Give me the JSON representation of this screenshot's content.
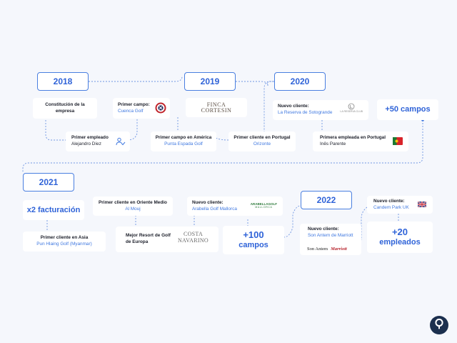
{
  "years": [
    "2018",
    "2019",
    "2020",
    "2021",
    "2022"
  ],
  "cards": {
    "constitucion": {
      "title": "Constitución de la empresa"
    },
    "primer_empleado": {
      "title": "Primer empleado",
      "sub": "Alejandro Díez"
    },
    "primer_campo": {
      "title": "Primer campo:",
      "sub": "Cuenca Golf"
    },
    "finca": {
      "logo_line1": "FINCA",
      "logo_line2": "CORTESIN"
    },
    "primer_campo_america": {
      "title": "Primer campo en América",
      "sub": "Punta Espada Golf"
    },
    "primer_cliente_portugal": {
      "title": "Primer cliente en Portugal",
      "sub": "Orizonte"
    },
    "reserva": {
      "title": "Nuevo cliente:",
      "sub": "La Reserva de Sotogrande",
      "logo_text": "LA RESERVA CLUB"
    },
    "primera_empleada_portugal": {
      "title": "Primera empleada en Portugal",
      "sub": "Inês Parente"
    },
    "campos_50": {
      "text": "+50 campos"
    },
    "x2": {
      "text": "x2 facturación"
    },
    "asia": {
      "title": "Primer cliente en Asia",
      "sub": "Pun Hlaing Golf (Myanmar)"
    },
    "oriente": {
      "title": "Primer cliente en Oriente Medio",
      "sub": "Al Mouj"
    },
    "mejor_resort": {
      "title": "Mejor Resort de Golf de Europa",
      "logo_line1": "COSTA",
      "logo_line2": "NAVARINO"
    },
    "arabella": {
      "title": "Nuevo cliente:",
      "sub": "Arabella Golf Mallorca",
      "logo_line1": "ARABELLAGOLF",
      "logo_line2": "MALLORCA"
    },
    "campos_100": {
      "line1": "+100",
      "line2": "campos"
    },
    "son_antem": {
      "title": "Nuevo cliente:",
      "sub": "Son Antem de Marriott",
      "logo1": "Son Antem",
      "logo2": "Marriott"
    },
    "candem": {
      "title": "Nuevo cliente:",
      "sub": "Candem Park UK"
    },
    "empleados_20": {
      "line1": "+20",
      "line2": "empleados"
    }
  },
  "icons": [
    "cuenca-golf-logo",
    "handshake-icon",
    "portugal-flag-icon",
    "uk-flag-icon",
    "chat-icon"
  ],
  "colors": {
    "accent": "#2f63d8",
    "link": "#3f78e0",
    "background": "#f5f7fc",
    "chat": "#1b2f4e"
  }
}
